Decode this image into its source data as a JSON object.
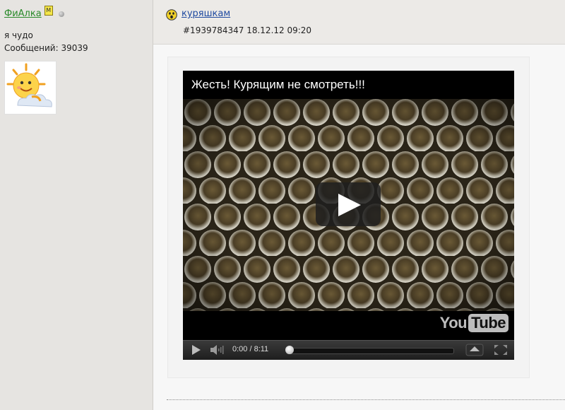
{
  "sidebar": {
    "username": "ФиАлка",
    "badge": "M",
    "user_title": "я чудо",
    "post_count": "Сообщений: 39039"
  },
  "post": {
    "topic_title": "куряшкам",
    "meta": "#1939784347 18.12.12 09:20"
  },
  "video": {
    "title": "Жесть! Курящим не смотреть!!!",
    "time": "0:00 / 8:11",
    "progress": 0,
    "logo_you": "You",
    "logo_tube": "Tube"
  },
  "colors": {
    "sidebar_bg": "#e6e4e1",
    "username": "#2a8a2a",
    "link": "#1f4aa0"
  }
}
